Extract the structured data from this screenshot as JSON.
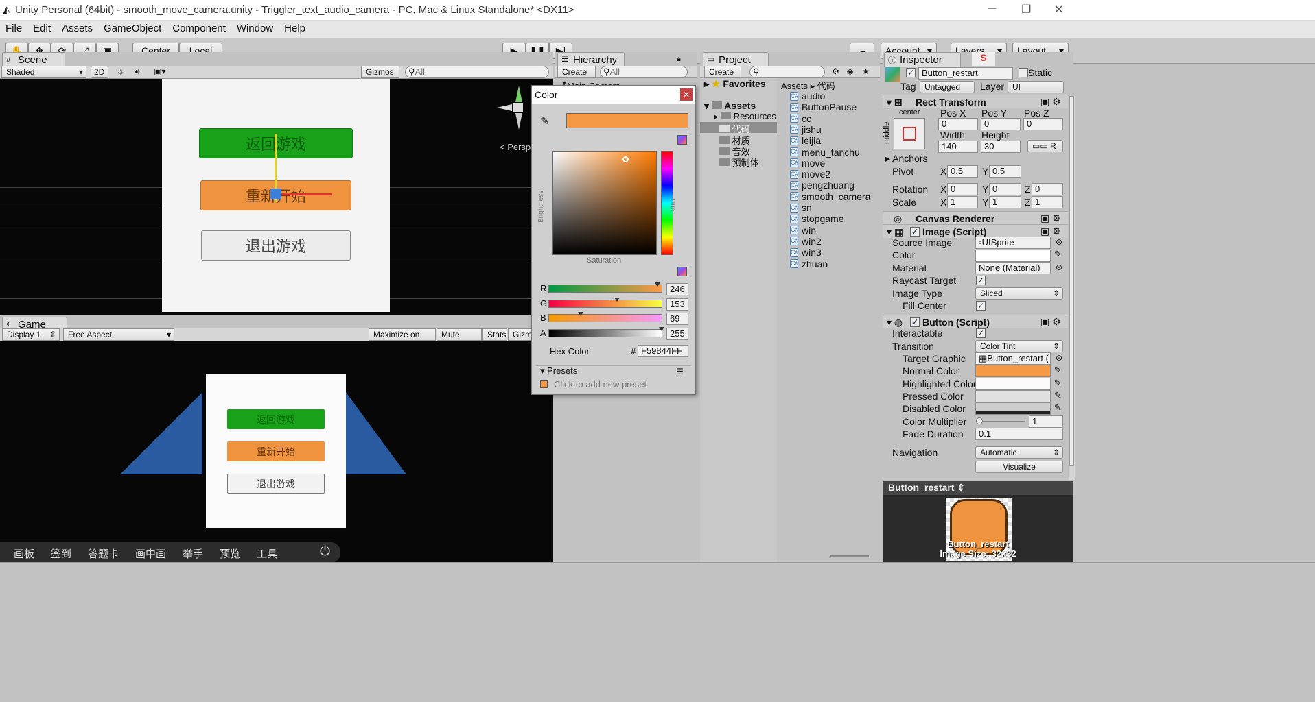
{
  "window": {
    "title": "Unity Personal (64bit) - smooth_move_camera.unity - Triggler_text_audio_camera - PC, Mac & Linux Standalone* <DX11>",
    "minimize": "─",
    "maximize": "❐",
    "close": "✕"
  },
  "menu": [
    "File",
    "Edit",
    "Assets",
    "GameObject",
    "Component",
    "Window",
    "Help"
  ],
  "toolbar": {
    "center": "Center",
    "local": "Local",
    "account": "Account",
    "layers": "Layers",
    "layout": "Layout"
  },
  "scene": {
    "tab": "Scene",
    "shading": "Shaded",
    "mode2d": "2D",
    "gizmos": "Gizmos",
    "search": "All",
    "persp": "< Persp",
    "buttons": [
      "返回游戏",
      "重新开始",
      "退出游戏"
    ]
  },
  "game": {
    "tab": "Game",
    "display": "Display 1",
    "aspect": "Free Aspect",
    "maximize": "Maximize on Play",
    "mute": "Mute audio",
    "stats": "Stats",
    "gizmos": "Gizmos",
    "buttons": [
      "返回游戏",
      "重新开始",
      "退出游戏"
    ]
  },
  "taskbar": {
    "items": [
      "画板",
      "签到",
      "答题卡",
      "画中画",
      "举手",
      "预览",
      "工具"
    ]
  },
  "hierarchy": {
    "tab": "Hierarchy",
    "create": "Create",
    "search": "All",
    "item": "Main Camera"
  },
  "project": {
    "tab": "Project",
    "create": "Create",
    "favorites": "Favorites",
    "assets": "Assets",
    "folders": [
      "Resources",
      "代码",
      "材质",
      "音效",
      "预制体"
    ],
    "breadcrumb_root": "Assets",
    "breadcrumb_child": "代码",
    "files": [
      "audio",
      "ButtonPause",
      "cc",
      "jishu",
      "leijia",
      "menu_tanchu",
      "move",
      "move2",
      "pengzhuang",
      "smooth_camera",
      "sn",
      "stopgame",
      "win",
      "win2",
      "win3",
      "zhuan"
    ]
  },
  "color_picker": {
    "title": "Color",
    "brightness": "Brightness",
    "saturation": "Saturation",
    "hue": "Hue",
    "channels": [
      {
        "label": "R",
        "value": "246",
        "pos": 0.965
      },
      {
        "label": "G",
        "value": "153",
        "pos": 0.6
      },
      {
        "label": "B",
        "value": "69",
        "pos": 0.27
      },
      {
        "label": "A",
        "value": "255",
        "pos": 1.0
      }
    ],
    "hex_label": "Hex Color",
    "hex_hash": "#",
    "hex": "F59844FF",
    "presets": "Presets",
    "add_preset": "Click to add new preset",
    "swatch": "#f59844"
  },
  "inspector": {
    "tab": "Inspector",
    "name": "Button_restart",
    "static": "Static",
    "tag_label": "Tag",
    "tag": "Untagged",
    "layer_label": "Layer",
    "layer": "UI",
    "rect": {
      "title": "Rect Transform",
      "anchor_h": "center",
      "anchor_v": "middle",
      "posx_l": "Pos X",
      "posy_l": "Pos Y",
      "posz_l": "Pos Z",
      "posx": "0",
      "posy": "0",
      "posz": "0",
      "width_l": "Width",
      "height_l": "Height",
      "width": "140",
      "height": "30",
      "r": "R",
      "anchors": "Anchors",
      "pivot": "Pivot",
      "px": "0.5",
      "py": "0.5",
      "rotation": "Rotation",
      "rx": "0",
      "ry": "0",
      "rz": "0",
      "scale": "Scale",
      "sx": "1",
      "sy": "1",
      "sz": "1",
      "x": "X",
      "y": "Y",
      "z": "Z"
    },
    "canvas_renderer": "Canvas Renderer",
    "image": {
      "title": "Image (Script)",
      "source_l": "Source Image",
      "source": "UISprite",
      "color_l": "Color",
      "material_l": "Material",
      "material": "None (Material)",
      "raycast_l": "Raycast Target",
      "type_l": "Image Type",
      "type": "Sliced",
      "fill_l": "Fill Center"
    },
    "button": {
      "title": "Button (Script)",
      "interactable_l": "Interactable",
      "transition_l": "Transition",
      "transition": "Color Tint",
      "target_l": "Target Graphic",
      "target": "Button_restart (",
      "normal_l": "Normal Color",
      "highlighted_l": "Highlighted Color",
      "pressed_l": "Pressed Color",
      "disabled_l": "Disabled Color",
      "multiplier_l": "Color Multiplier",
      "multiplier": "1",
      "fade_l": "Fade Duration",
      "fade": "0.1",
      "nav_l": "Navigation",
      "nav": "Automatic",
      "visualize": "Visualize"
    },
    "preview": {
      "title": "Button_restart",
      "name": "Button_restart",
      "size": "Image Size: 32x32"
    }
  }
}
